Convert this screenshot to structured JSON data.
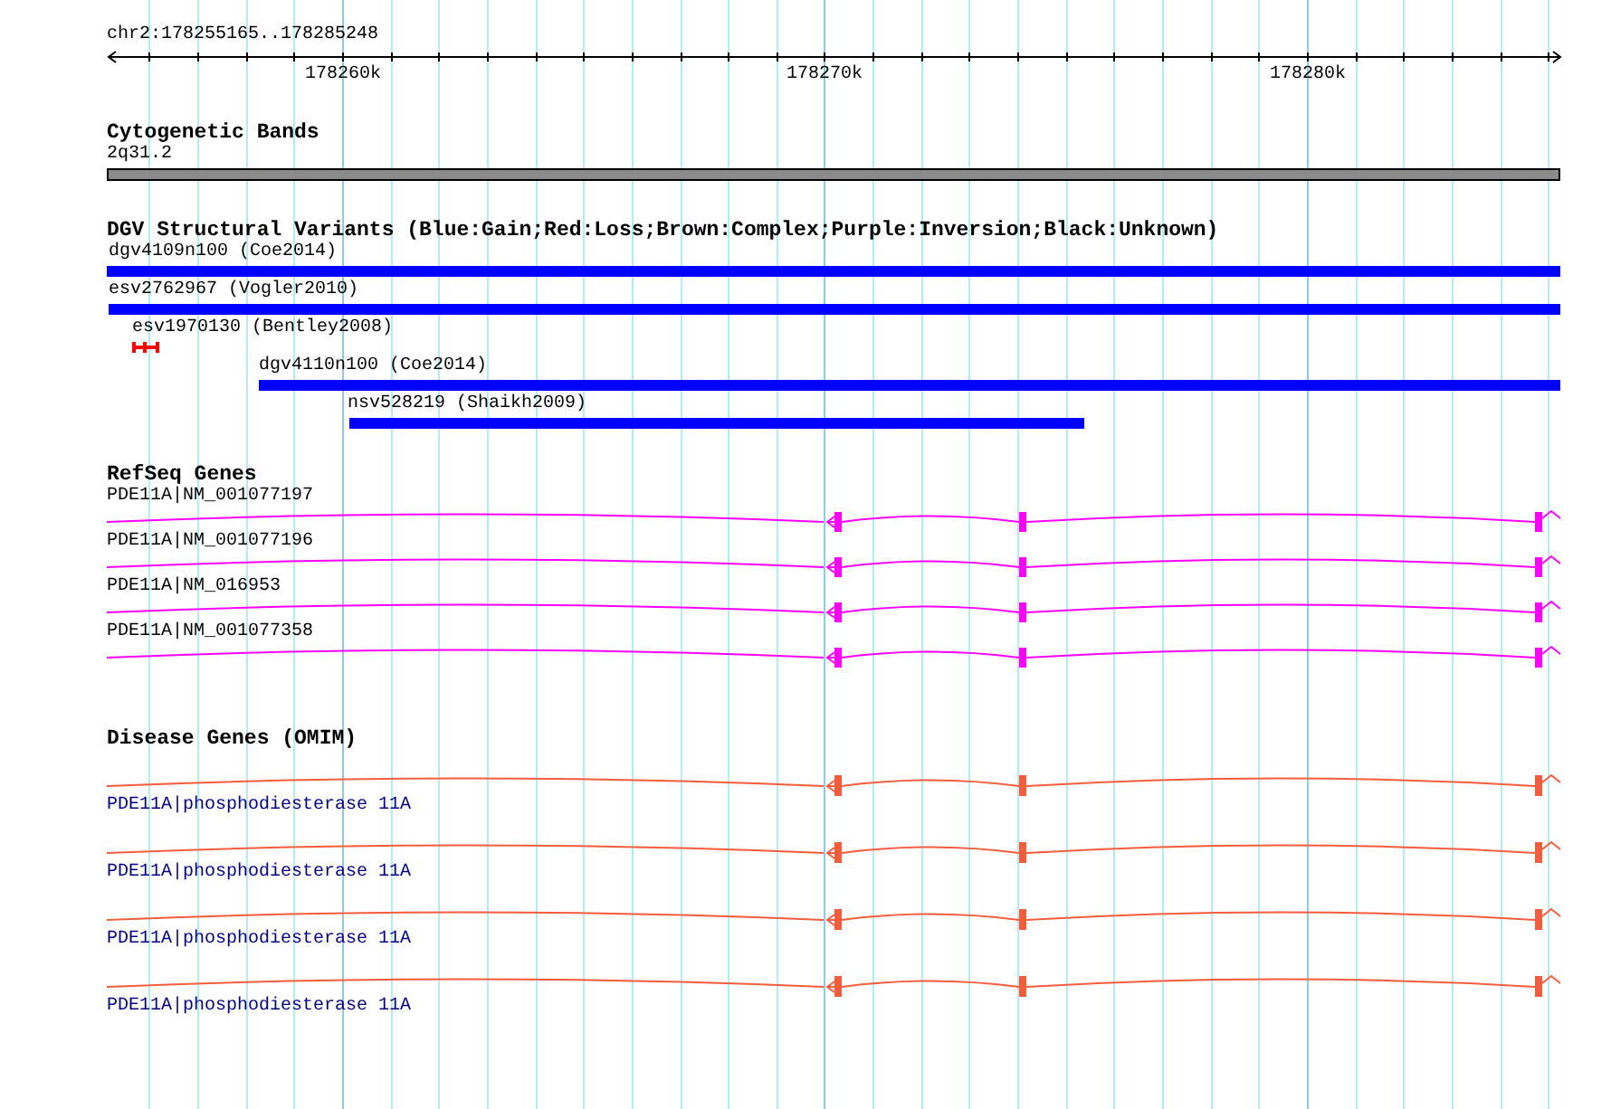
{
  "ruler": {
    "region": "chr2:178255165..178285248",
    "ticks": [
      "178260k",
      "178270k",
      "178280k"
    ]
  },
  "tracks": [
    {
      "kind": "band",
      "title": "Cytogenetic Bands",
      "features": [
        {
          "label": "2q31.2"
        }
      ]
    },
    {
      "kind": "variant",
      "title": "DGV Structural Variants (Blue:Gain;Red:Loss;Brown:Complex;Purple:Inversion;Black:Unknown)",
      "features": [
        {
          "label": "dgv4109n100 (Coe2014)",
          "color": "#0000ff"
        },
        {
          "label": "esv2762967 (Vogler2010)",
          "color": "#0000ff"
        },
        {
          "label": "esv1970130 (Bentley2008)",
          "color": "#ff0000"
        },
        {
          "label": "dgv4110n100 (Coe2014)",
          "color": "#0000ff"
        },
        {
          "label": "nsv528219 (Shaikh2009)",
          "color": "#0000ff"
        }
      ]
    },
    {
      "kind": "refseq",
      "title": "RefSeq Genes",
      "features": [
        {
          "label": "PDE11A|NM_001077197"
        },
        {
          "label": "PDE11A|NM_001077196"
        },
        {
          "label": "PDE11A|NM_016953"
        },
        {
          "label": "PDE11A|NM_001077358"
        }
      ]
    },
    {
      "kind": "omim",
      "title": "Disease Genes (OMIM)",
      "features": [
        {
          "label": "PDE11A|phosphodiesterase 11A"
        },
        {
          "label": "PDE11A|phosphodiesterase 11A"
        },
        {
          "label": "PDE11A|phosphodiesterase 11A"
        },
        {
          "label": "PDE11A|phosphodiesterase 11A"
        }
      ]
    }
  ]
}
